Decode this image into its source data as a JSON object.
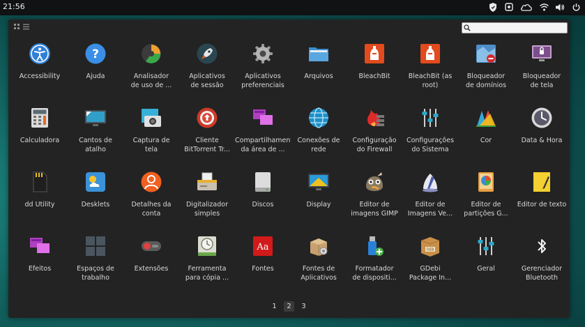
{
  "topbar": {
    "clock": "21:56",
    "tray": [
      "shield-icon",
      "network-manager-icon",
      "cloud-icon",
      "wifi-icon",
      "volume-icon",
      "power-icon"
    ]
  },
  "search": {
    "placeholder": "",
    "value": ""
  },
  "apps": [
    {
      "label": "Accessibility",
      "icon": "accessibility-icon"
    },
    {
      "label": "Ajuda",
      "icon": "help-icon"
    },
    {
      "label": "Analisador\nde uso de ...",
      "icon": "disk-usage-icon"
    },
    {
      "label": "Aplicativos\nde sessão",
      "icon": "rocket-icon"
    },
    {
      "label": "Aplicativos\npreferenciais",
      "icon": "gear-icon"
    },
    {
      "label": "Arquivos",
      "icon": "folder-icon"
    },
    {
      "label": "BleachBit",
      "icon": "bleachbit-icon"
    },
    {
      "label": "BleachBit (as\nroot)",
      "icon": "bleachbit-root-icon"
    },
    {
      "label": "Bloqueador\nde domínios",
      "icon": "domain-blocker-icon"
    },
    {
      "label": "Bloqueador\nde tela",
      "icon": "screen-lock-icon"
    },
    {
      "label": "Calculadora",
      "icon": "calculator-icon"
    },
    {
      "label": "Cantos de\natalho",
      "icon": "hot-corners-icon"
    },
    {
      "label": "Captura de\ntela",
      "icon": "screenshot-icon"
    },
    {
      "label": "Cliente\nBitTorrent Tr...",
      "icon": "torrent-icon"
    },
    {
      "label": "Compartilhamento\nda área de ...",
      "icon": "desktop-sharing-icon"
    },
    {
      "label": "Conexões de\nrede",
      "icon": "network-globe-icon"
    },
    {
      "label": "Configuração\ndo Firewall",
      "icon": "firewall-icon"
    },
    {
      "label": "Configurações\ndo Sistema",
      "icon": "sliders-icon"
    },
    {
      "label": "Cor",
      "icon": "color-icon"
    },
    {
      "label": "Data & Hora",
      "icon": "clock-icon"
    },
    {
      "label": "dd Utility",
      "icon": "sd-card-icon"
    },
    {
      "label": "Desklets",
      "icon": "weather-desklet-icon"
    },
    {
      "label": "Detalhes da\nconta",
      "icon": "user-account-icon"
    },
    {
      "label": "Digitalizador\nsimples",
      "icon": "scanner-icon"
    },
    {
      "label": "Discos",
      "icon": "disk-icon"
    },
    {
      "label": "Display",
      "icon": "display-icon"
    },
    {
      "label": "Editor de\nimagens GIMP",
      "icon": "gimp-icon"
    },
    {
      "label": "Editor de\nImagens Ve...",
      "icon": "vector-editor-icon"
    },
    {
      "label": "Editor de\npartições G...",
      "icon": "gparted-icon"
    },
    {
      "label": "Editor de texto",
      "icon": "text-editor-icon"
    },
    {
      "label": "Efeitos",
      "icon": "effects-icon"
    },
    {
      "label": "Espaços de\ntrabalho",
      "icon": "workspaces-icon"
    },
    {
      "label": "Extensões",
      "icon": "extensions-toggle-icon"
    },
    {
      "label": "Ferramenta\npara cópia ...",
      "icon": "backup-icon"
    },
    {
      "label": "Fontes",
      "icon": "fonts-icon"
    },
    {
      "label": "Fontes de\nAplicativos",
      "icon": "software-sources-icon"
    },
    {
      "label": "Formatador\nde dispositi...",
      "icon": "usb-formatter-icon"
    },
    {
      "label": "GDebi\nPackage In...",
      "icon": "gdebi-icon"
    },
    {
      "label": "Geral",
      "icon": "general-sliders-icon"
    },
    {
      "label": "Gerenciador\nBluetooth",
      "icon": "bluetooth-icon"
    }
  ],
  "pagination": {
    "pages": [
      "1",
      "2",
      "3"
    ],
    "active_index": 1
  },
  "colors": {
    "menu_bg": "#232323",
    "label": "#d9d9d9",
    "accent_blue": "#2f8fd8"
  }
}
